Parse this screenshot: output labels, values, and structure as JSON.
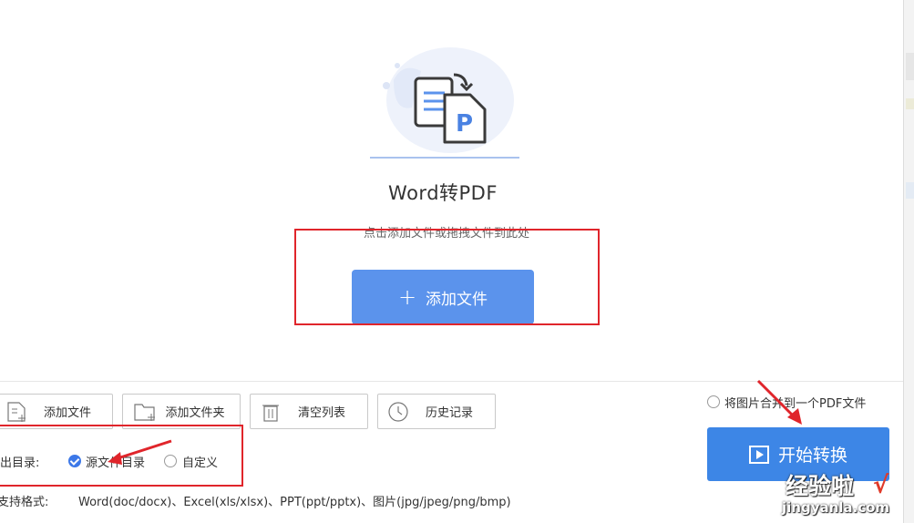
{
  "main": {
    "title": "Word转PDF",
    "hint": "点击添加文件或拖拽文件到此处",
    "add_file_label": "添加文件",
    "plus_glyph": "+"
  },
  "toolbar": {
    "buttons": [
      {
        "label": "添加文件",
        "icon": "add-file-icon"
      },
      {
        "label": "添加文件夹",
        "icon": "add-folder-icon"
      },
      {
        "label": "清空列表",
        "icon": "trash-icon"
      },
      {
        "label": "历史记录",
        "icon": "clock-icon"
      }
    ]
  },
  "output": {
    "label": "输出目录:",
    "options": [
      {
        "label": "源文件目录",
        "checked": true
      },
      {
        "label": "自定义",
        "checked": false
      }
    ]
  },
  "formats": {
    "label": "支持格式:",
    "value": "Word(doc/docx)、Excel(xls/xlsx)、PPT(ppt/pptx)、图片(jpg/jpeg/png/bmp)"
  },
  "merge_option": {
    "label": "将图片合并到一个PDF文件",
    "checked": false
  },
  "start_button": {
    "label": "开始转换"
  },
  "watermark": {
    "line1": "经验啦",
    "line2": "jingyanla.com",
    "check": "√"
  },
  "colors": {
    "accent": "#5b93ec",
    "start_button": "#3d86e6",
    "annotation_red": "#e0252b",
    "radio_checked": "#3c78e8"
  }
}
